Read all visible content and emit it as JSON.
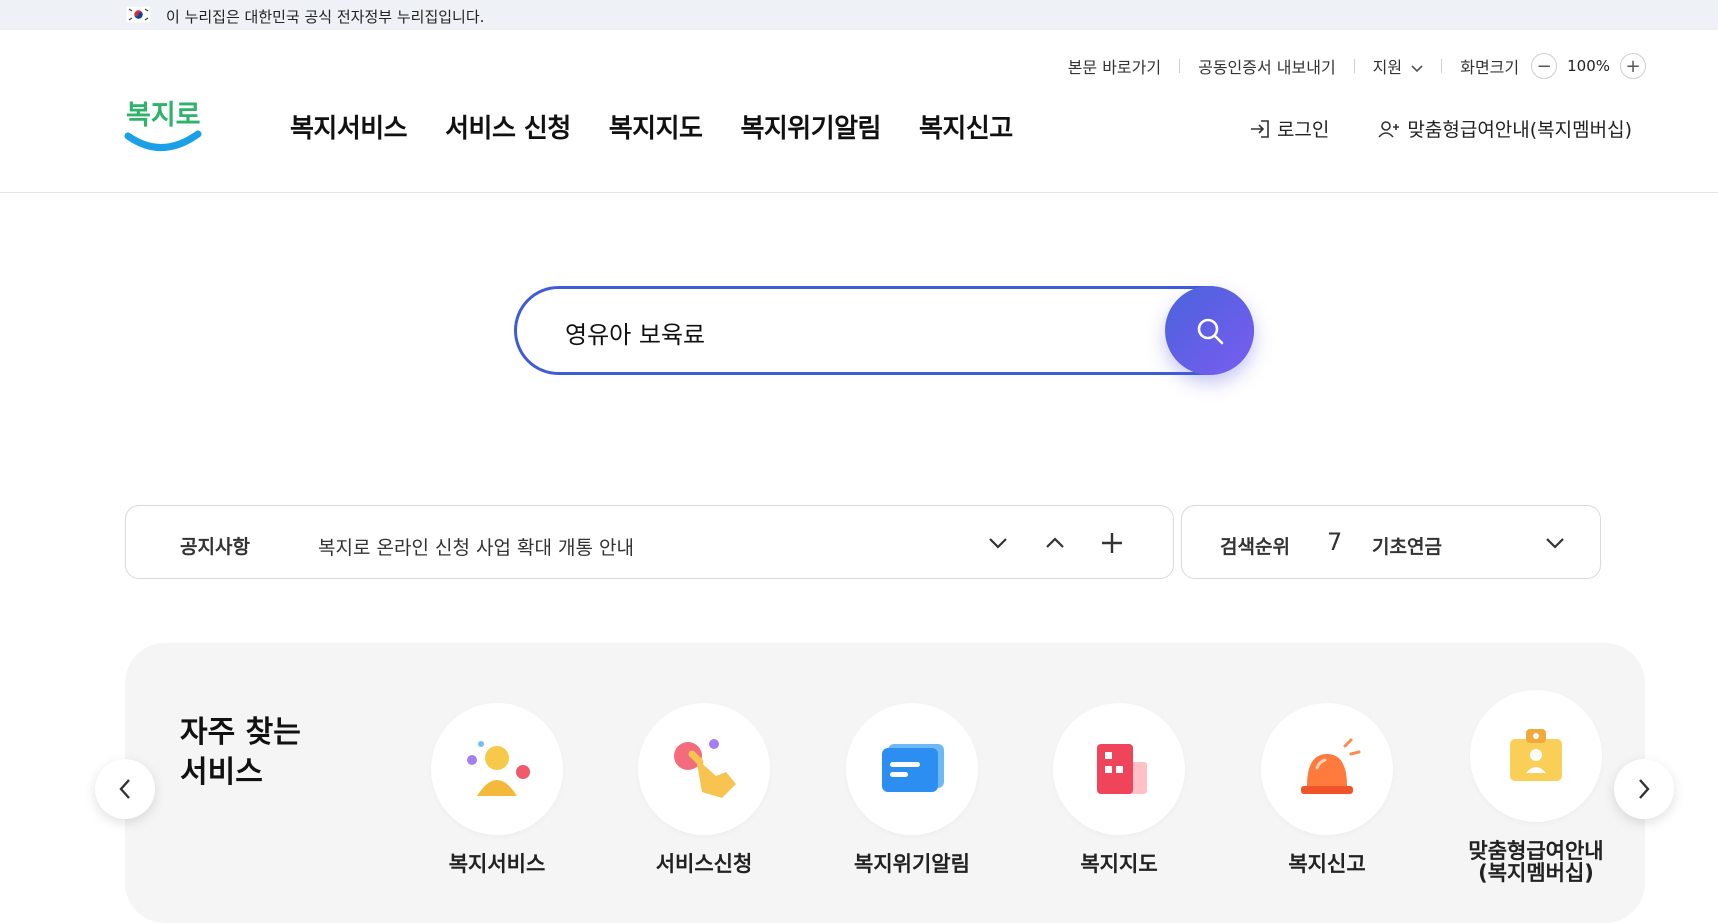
{
  "gov_banner": {
    "text": "이 누리집은 대한민국 공식 전자정부 누리집입니다."
  },
  "utility": {
    "skip_link": "본문 바로가기",
    "cert_export": "공동인증서 내보내기",
    "support": "지원",
    "zoom_label": "화면크기",
    "zoom_value": "100%"
  },
  "logo": {
    "text": "복지로"
  },
  "gnb": [
    {
      "label": "복지서비스"
    },
    {
      "label": "서비스 신청"
    },
    {
      "label": "복지지도"
    },
    {
      "label": "복지위기알림"
    },
    {
      "label": "복지신고"
    }
  ],
  "user_menu": {
    "login": "로그인",
    "membership": "맞춤형급여안내(복지멤버십)"
  },
  "search": {
    "value": "영유아 보육료"
  },
  "notice": {
    "label": "공지사항",
    "text": "복지로 온라인 신청 사업 확대 개통 안내"
  },
  "rank": {
    "label": "검색순위",
    "number": "7",
    "keyword": "기초연금"
  },
  "frequent": {
    "title_line1": "자주 찾는",
    "title_line2": "서비스",
    "items": [
      {
        "label": "복지서비스",
        "icon": "person-icon"
      },
      {
        "label": "서비스신청",
        "icon": "hand-tap-icon"
      },
      {
        "label": "복지위기알림",
        "icon": "message-icon"
      },
      {
        "label": "복지지도",
        "icon": "building-map-icon"
      },
      {
        "label": "복지신고",
        "icon": "siren-icon"
      },
      {
        "label": "맞춤형급여안내\n(복지멤버십)",
        "label_line1": "맞춤형급여안내",
        "label_line2": "(복지멤버십)",
        "icon": "id-card-icon"
      }
    ]
  },
  "colors": {
    "accent": "#3f5bd7",
    "logo_blue": "#1aa0e6",
    "logo_green": "#2fb36b"
  }
}
